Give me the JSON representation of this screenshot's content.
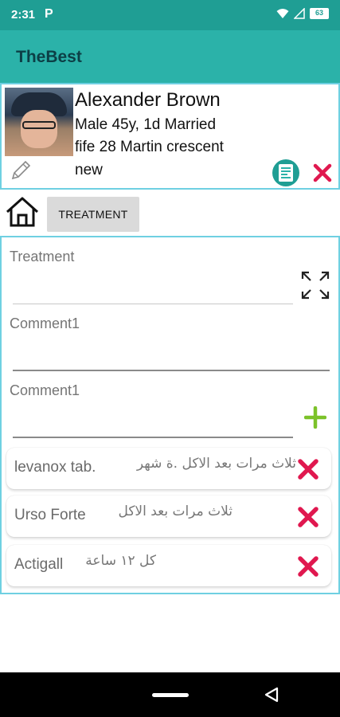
{
  "status_bar": {
    "time": "2:31",
    "notification": "P",
    "battery": "63"
  },
  "app_bar": {
    "title": "TheBest"
  },
  "patient": {
    "name": "Alexander Brown",
    "line1": "Male   45y, 1d  Married",
    "line2": "fife  28 Martin crescent",
    "line3": "new"
  },
  "nav": {
    "treatment_tab": "TREATMENT"
  },
  "form": {
    "treatment_label": "Treatment",
    "treatment_value": "",
    "comment1_label": "Comment1",
    "comment1_value": "",
    "comment2_label": "Comment1",
    "comment2_value": ""
  },
  "medications": [
    {
      "name": "levanox tab.",
      "note": "ثلاث مرات بعد الاكل .ة شهر"
    },
    {
      "name": "Urso Forte",
      "note": "ثلاث مرات بعد الاكل"
    },
    {
      "name": "Actigall",
      "note": "كل ١٢ ساعة"
    }
  ],
  "colors": {
    "status_bar": "#1f9e94",
    "app_bar": "#2bb2a9",
    "border": "#6fd0e2",
    "delete": "#e0184f",
    "add": "#7cc22a"
  },
  "icons": [
    "pencil-icon",
    "document-icon",
    "close-icon",
    "home-icon",
    "expand-icon",
    "plus-icon",
    "delete-icon",
    "back-icon"
  ]
}
